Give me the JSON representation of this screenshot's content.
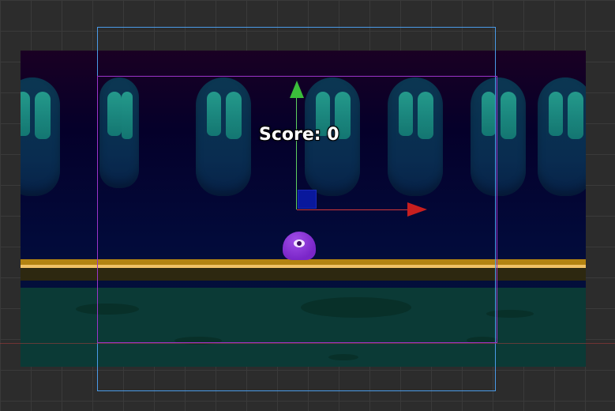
{
  "hud": {
    "score_label": "Score: 0"
  },
  "colors": {
    "editor_background": "#2c2c2c",
    "camera_frame_outline": "#4a9be8",
    "selection_outline": "#9b33c9",
    "y_axis_gizmo": "#3bbd3b",
    "x_axis_gizmo": "#c81f1f",
    "center_gizmo": "#0a1aa8",
    "player": "#8a35d8",
    "floor": "#0b3a36"
  },
  "icons": {
    "y_axis": "move-y-arrow-icon",
    "x_axis": "move-x-arrow-icon",
    "center": "move-xy-handle-icon",
    "player_eye": "eye-icon"
  }
}
